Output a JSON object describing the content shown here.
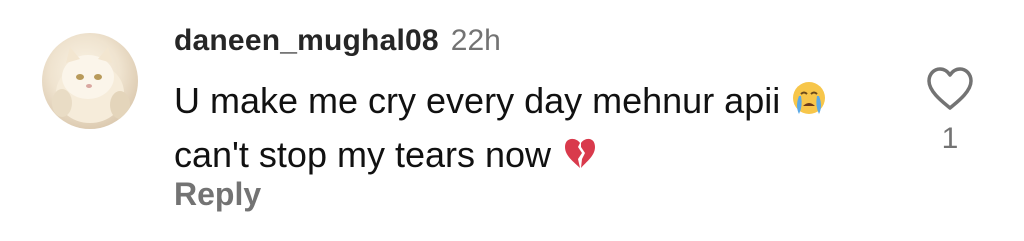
{
  "comment": {
    "username": "daneen_mughal08",
    "timestamp": "22h",
    "text_line_1": "U make me cry every day mehnur apii",
    "text_line_2": "can't stop my tears now",
    "emoji_1": "crying-face",
    "emoji_2": "broken-heart",
    "reply_label": "Reply",
    "like_count": "1",
    "avatar": "white-cat-photo"
  },
  "colors": {
    "username": "#262626",
    "secondary_text": "#737373",
    "body_text": "#111111",
    "emoji_yellow": "#f7c64a",
    "tear_blue": "#5aa9e6",
    "broken_heart_red": "#d93a4c"
  }
}
